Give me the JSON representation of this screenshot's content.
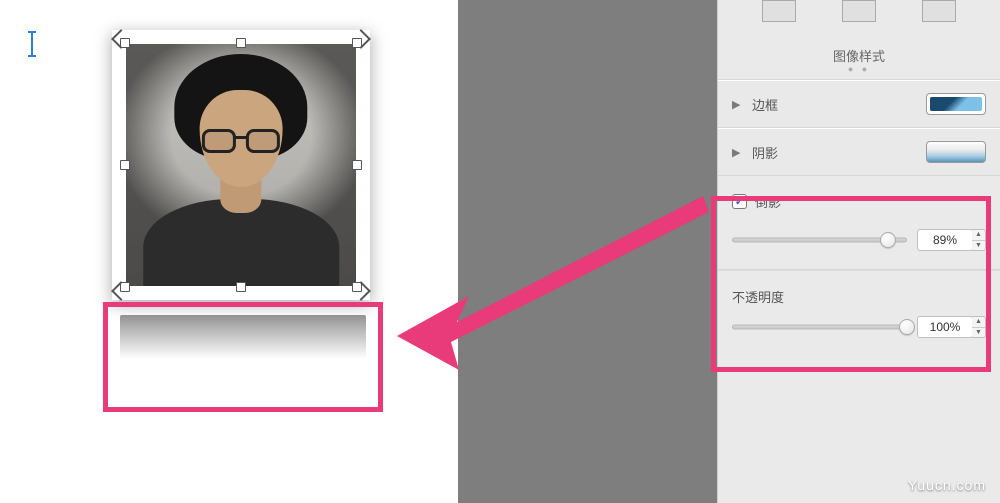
{
  "styles_header": {
    "title": "图像样式"
  },
  "sections": {
    "border": {
      "label": "边框"
    },
    "shadow": {
      "label": "阴影"
    },
    "reflection": {
      "label": "倒影",
      "checked": true,
      "value_display": "89%",
      "slider_percent": 89
    },
    "opacity": {
      "label": "不透明度",
      "value_display": "100%",
      "slider_percent": 100
    }
  },
  "watermark": "Yuucn.com"
}
